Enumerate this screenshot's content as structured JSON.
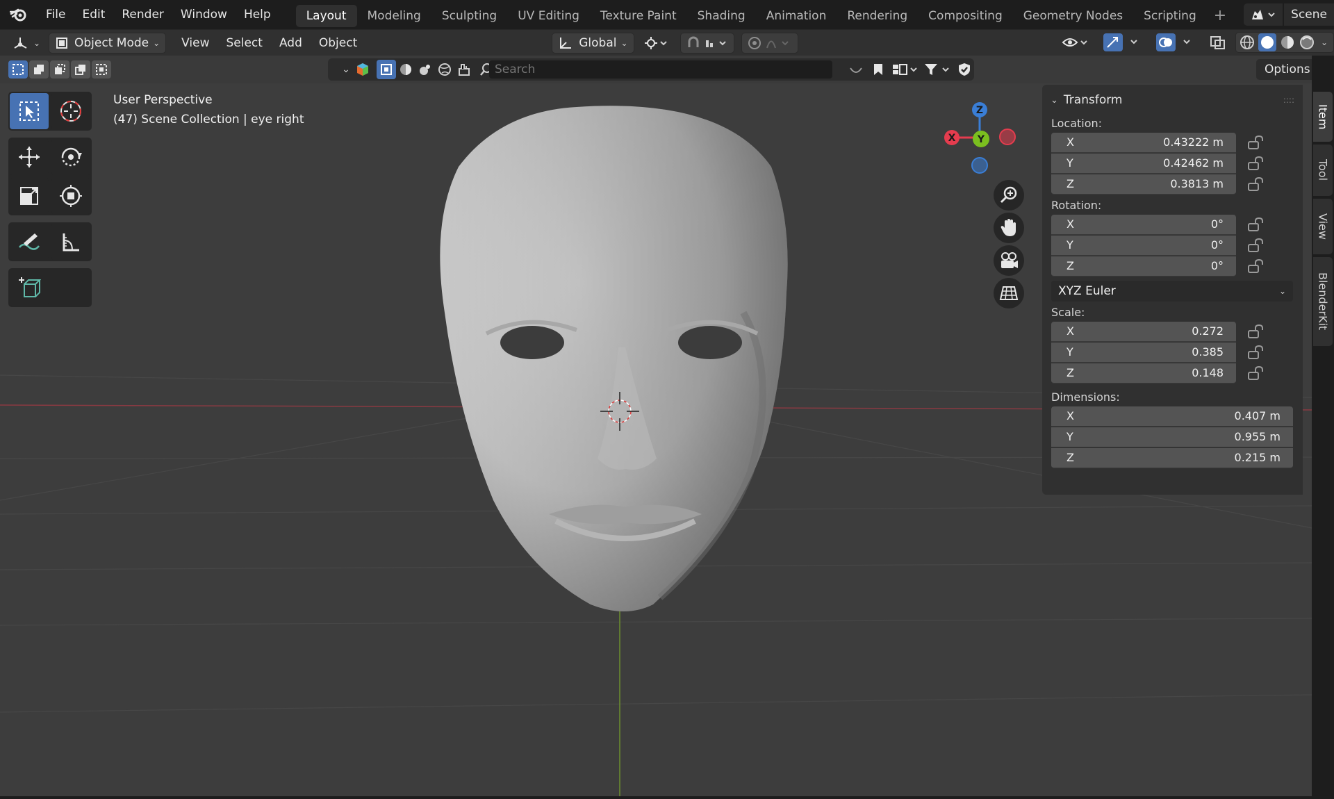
{
  "menubar": {
    "logo_icon": "blender-logo-icon",
    "items": [
      "File",
      "Edit",
      "Render",
      "Window",
      "Help"
    ]
  },
  "workspaces": {
    "tabs": [
      "Layout",
      "Modeling",
      "Sculpting",
      "UV Editing",
      "Texture Paint",
      "Shading",
      "Animation",
      "Rendering",
      "Compositing",
      "Geometry Nodes",
      "Scripting"
    ],
    "active": "Layout",
    "add_label": "+"
  },
  "scene": {
    "name": "Scene",
    "icon": "scene-icon"
  },
  "header": {
    "editor_type_icon": "3d-viewport-icon",
    "mode_label": "Object Mode",
    "menus": [
      "View",
      "Select",
      "Add",
      "Object"
    ],
    "transform_orientation": "Global",
    "pivot_icon": "pivot-point-icon",
    "snap_icon": "snap-icon",
    "proportional_icon": "proportional-editing-icon"
  },
  "toolheader": {
    "search_placeholder": "Search",
    "options_label": "Options"
  },
  "viewport": {
    "perspective_label": "User Perspective",
    "collection_label": "(47) Scene Collection | eye right",
    "gizmo": {
      "z_label": "Z",
      "y_label": "Y",
      "x_label": "X"
    },
    "colors": {
      "x_axis": "#e53c4e",
      "y_axis": "#7bbf1f",
      "z_axis": "#3a7ed6",
      "active_tool": "#4772b3"
    }
  },
  "properties": {
    "panel_title": "Transform",
    "location": {
      "label": "Location:",
      "x_label": "X",
      "x": "0.43222 m",
      "y_label": "Y",
      "y": "0.42462 m",
      "z_label": "Z",
      "z": "0.3813 m"
    },
    "rotation": {
      "label": "Rotation:",
      "x_label": "X",
      "x": "0°",
      "y_label": "Y",
      "y": "0°",
      "z_label": "Z",
      "z": "0°",
      "mode": "XYZ Euler"
    },
    "scale": {
      "label": "Scale:",
      "x_label": "X",
      "x": "0.272",
      "y_label": "Y",
      "y": "0.385",
      "z_label": "Z",
      "z": "0.148"
    },
    "dimensions": {
      "label": "Dimensions:",
      "x_label": "X",
      "x": "0.407 m",
      "y_label": "Y",
      "y": "0.955 m",
      "z_label": "Z",
      "z": "0.215 m"
    }
  },
  "sidebar_tabs": [
    "Item",
    "Tool",
    "View",
    "BlenderKit"
  ]
}
